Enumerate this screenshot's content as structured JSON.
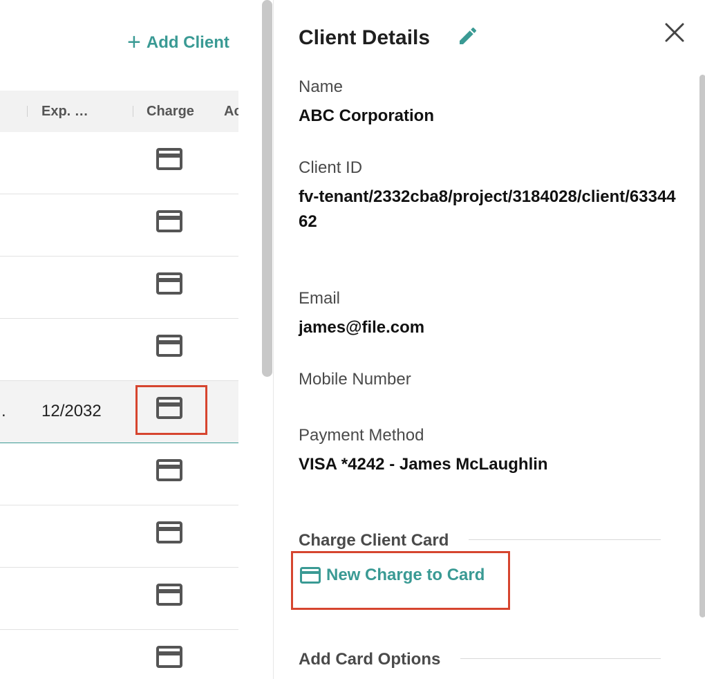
{
  "table": {
    "add_client_label": "Add Client",
    "add_client_plus": "+",
    "columns": [
      "Exp. …",
      "Charge",
      "Ac"
    ],
    "selected_row": {
      "dot": ".",
      "exp": "12/2032"
    }
  },
  "panel": {
    "title": "Client Details",
    "fields": [
      {
        "label": "Name",
        "value": "ABC Corporation"
      },
      {
        "label": "Client ID",
        "value": "fv-tenant/2332cba8/project/3184028/client/6334462"
      },
      {
        "label": "Email",
        "value": "james@file.com"
      },
      {
        "label": "Mobile Number",
        "value": ""
      },
      {
        "label": "Payment Method",
        "value": "VISA *4242 - James McLaughlin"
      }
    ],
    "charge_section_title": "Charge Client Card",
    "new_charge_label": "New Charge to Card",
    "add_card_section_title": "Add Card Options"
  },
  "colors": {
    "accent": "#3a9a94",
    "highlight": "#d6452f"
  },
  "icons": [
    "plus-icon",
    "credit-card-icon",
    "pencil-icon",
    "close-icon"
  ]
}
